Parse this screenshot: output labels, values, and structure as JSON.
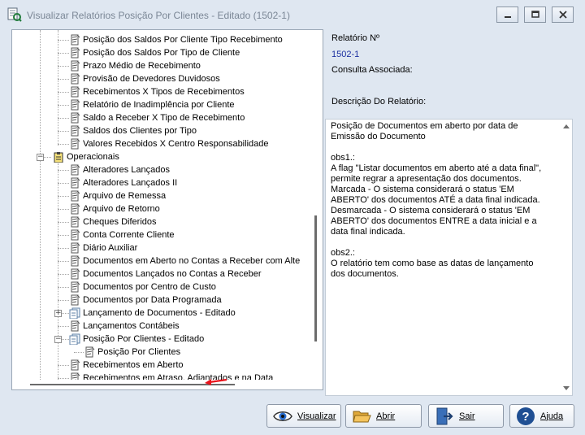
{
  "window": {
    "title": "Visualizar Relatórios Posição Por Clientes - Editado (1502-1)"
  },
  "tree": {
    "items": [
      {
        "label": "Posição dos Saldos Por Cliente Tipo Recebimento",
        "kind": "report"
      },
      {
        "label": "Posição dos Saldos Por Tipo de Cliente",
        "kind": "report"
      },
      {
        "label": "Prazo Médio de Recebimento",
        "kind": "report"
      },
      {
        "label": "Provisão de Devedores Duvidosos",
        "kind": "report"
      },
      {
        "label": "Recebimentos X Tipos de Recebimentos",
        "kind": "report"
      },
      {
        "label": "Relatório de Inadimplência por Cliente",
        "kind": "report"
      },
      {
        "label": "Saldo a Receber X Tipo de Recebimento",
        "kind": "report"
      },
      {
        "label": "Saldos dos Clientes por Tipo",
        "kind": "report"
      },
      {
        "label": "Valores Recebidos X Centro Responsabilidade",
        "kind": "report"
      },
      {
        "label": "Operacionais",
        "kind": "folder",
        "expanded": true
      },
      {
        "label": "Alteradores  Lançados",
        "kind": "report"
      },
      {
        "label": "Alteradores  Lançados II",
        "kind": "report"
      },
      {
        "label": "Arquivo de Remessa",
        "kind": "report"
      },
      {
        "label": "Arquivo de Retorno",
        "kind": "report"
      },
      {
        "label": "Cheques Diferidos",
        "kind": "report"
      },
      {
        "label": "Conta Corrente Cliente",
        "kind": "report"
      },
      {
        "label": "Diário  Auxiliar",
        "kind": "report"
      },
      {
        "label": "Documentos em Aberto no Contas a Receber com Alte",
        "kind": "report"
      },
      {
        "label": "Documentos Lançados no Contas a Receber",
        "kind": "report"
      },
      {
        "label": "Documentos por Centro de Custo",
        "kind": "report"
      },
      {
        "label": "Documentos por Data Programada",
        "kind": "report"
      },
      {
        "label": "Lançamento  de Documentos - Editado",
        "kind": "group",
        "expanded": false
      },
      {
        "label": "Lançamentos Contábeis",
        "kind": "report"
      },
      {
        "label": "Posição Por Clientes - Editado",
        "kind": "group",
        "expanded": true
      },
      {
        "label": "Posição Por Clientes",
        "kind": "report",
        "selected": true
      },
      {
        "label": "Recebimentos em Aberto",
        "kind": "report"
      },
      {
        "label": "Recebimentos em Atraso, Adiantados e na Data",
        "kind": "report"
      }
    ]
  },
  "info": {
    "report_number_label": "Relatório Nº",
    "report_number_value": "1502-1",
    "associated_query_label": "Consulta Associada:",
    "description_label": "Descrição Do Relatório:"
  },
  "description": "Posição de Documentos em aberto por data de\nEmissão do Documento\n\nobs1.:\nA flag \"Listar documentos em aberto até a data final\",\npermite regrar a apresentação dos documentos.\nMarcada - O sistema considerará o status 'EM\nABERTO' dos documentos ATÉ a data final indicada.\nDesmarcada - O sistema considerará o status 'EM\nABERTO' dos documentos ENTRE a data inicial e a\ndata final indicada.\n\nobs2.:\nO relatório tem como base as datas de lançamento\ndos documentos.",
  "buttons": {
    "visualizar": "Visualizar",
    "abrir": "Abrir",
    "sair": "Sair",
    "ajuda": "Ajuda"
  },
  "colors": {
    "accent_red": "#e8141c",
    "value_blue": "#1b2fa0"
  }
}
